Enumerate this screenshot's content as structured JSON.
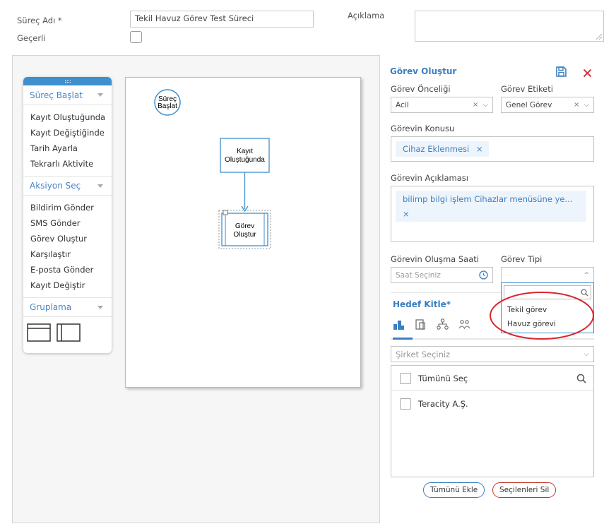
{
  "form": {
    "process_name_label": "Süreç Adı *",
    "process_name_value": "Tekil Havuz Görev Test Süreci",
    "valid_label": "Geçerli",
    "description_label": "Açıklama"
  },
  "palette": {
    "sections": [
      {
        "label": "Süreç Başlat",
        "items": [
          "Kayıt Oluştuğunda",
          "Kayıt Değiştiğinde",
          "Tarih Ayarla",
          "Tekrarlı Aktivite"
        ]
      },
      {
        "label": "Aksiyon Seç",
        "items": [
          "Bildirim Gönder",
          "SMS Gönder",
          "Görev Oluştur",
          "Karşılaştır",
          "E-posta Gönder",
          "Kayıt Değiştir"
        ]
      },
      {
        "label": "Gruplama",
        "items": []
      }
    ]
  },
  "canvas": {
    "start_node": [
      "Süreç",
      "Başlat"
    ],
    "trigger_node": [
      "Kayıt",
      "Oluştuğunda"
    ],
    "task_node": [
      "Görev",
      "Oluştur"
    ]
  },
  "panel": {
    "title": "Görev Oluştur",
    "priority_label": "Görev Önceliği",
    "priority_value": "Acil",
    "tag_label": "Görev Etiketi",
    "tag_value": "Genel Görev",
    "subject_label": "Görevin Konusu",
    "subject_chip": "Cihaz Eklenmesi",
    "desc_label": "Görevin Açıklaması",
    "desc_chip": "bilimp bilgi işlem Cihazlar menüsüne ye...",
    "time_label": "Görevin Oluşma Saati",
    "time_placeholder": "Saat Seçiniz",
    "type_label": "Görev Tipi",
    "type_options": [
      "Tekil görev",
      "Havuz görevi"
    ],
    "audience_label": "Hedef Kitle*",
    "company_placeholder": "Şirket Seçiniz",
    "select_all": "Tümünü Seç",
    "company_item": "Teracity A.Ş.",
    "add_all_btn": "Tümünü Ekle",
    "delete_selected_btn": "Seçilenleri Sil",
    "remove_glyph": "×"
  },
  "colors": {
    "accent": "#3a7fc1",
    "close": "#d9363e",
    "highlight_ellipse": "#d9262e"
  }
}
